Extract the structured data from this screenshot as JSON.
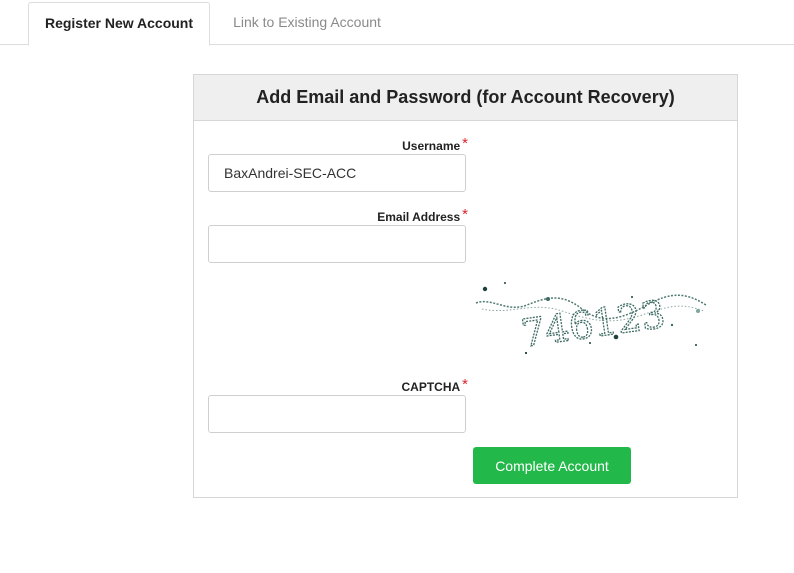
{
  "tabs": {
    "register_label": "Register New Account",
    "link_label": "Link to Existing Account",
    "active": "register"
  },
  "panel": {
    "title": "Add Email and Password (for Account Recovery)"
  },
  "form": {
    "username_label": "Username",
    "username_value": "BaxAndrei-SEC-ACC",
    "email_label": "Email Address",
    "email_value": "",
    "captcha_label": "CAPTCHA",
    "captcha_value": "",
    "captcha_image_text": "746123",
    "required_marker": "*",
    "submit_label": "Complete Account"
  },
  "colors": {
    "submit_button": "#23b84a",
    "required_marker": "#d9232d",
    "captcha_ink": "#3d6b63"
  }
}
